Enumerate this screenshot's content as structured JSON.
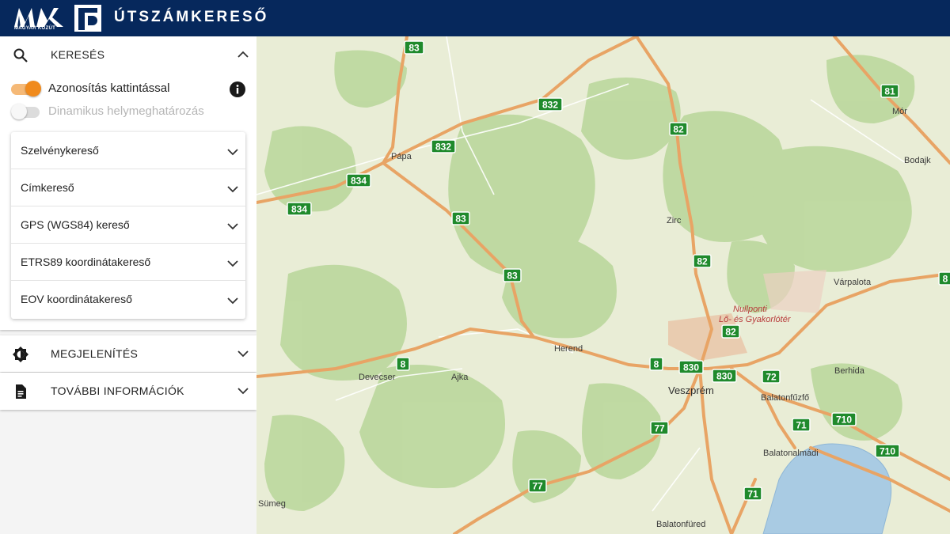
{
  "header": {
    "logo_text": "MAGYAR KÖZÚT",
    "title": "ÚTSZÁMKERESŐ"
  },
  "search_panel": {
    "title": "KERESÉS",
    "icon": "search-icon",
    "toggles": [
      {
        "label": "Azonosítás kattintással",
        "on": true
      },
      {
        "label": "Dinamikus helymeghatározás",
        "on": false
      }
    ],
    "accordion": [
      "Szelvénykereső",
      "Címkereső",
      "GPS (WGS84) kereső",
      "ETRS89 koordinátakereső",
      "EOV koordinátakereső"
    ]
  },
  "display_panel": {
    "title": "MEGJELENÍTÉS",
    "icon": "brightness-icon"
  },
  "info_panel": {
    "title": "TOVÁBBI INFORMÁCIÓK",
    "icon": "document-icon"
  },
  "map": {
    "shields": [
      "83",
      "81",
      "832",
      "82",
      "832",
      "834",
      "834",
      "83",
      "82",
      "83",
      "82",
      "8",
      "8",
      "830",
      "830",
      "72",
      "71",
      "710",
      "710",
      "77",
      "77",
      "71",
      "8"
    ],
    "towns": [
      "Mór",
      "Bodajk",
      "Pápa",
      "Zirc",
      "Várpalota",
      "Herend",
      "Devecser",
      "Ajka",
      "Veszprém",
      "Berhida",
      "Balatonfűzfő",
      "Balatonalmádi",
      "Sümeg",
      "Balatonfüred"
    ],
    "zone_label": [
      "Nullponti",
      "Lő- és Gyakorlótér"
    ]
  },
  "colors": {
    "header_bg": "#06285c",
    "accent": "#f08a1c",
    "road": "#e8a465",
    "shield": "#1f8a2c",
    "water": "#a9cbe3"
  }
}
